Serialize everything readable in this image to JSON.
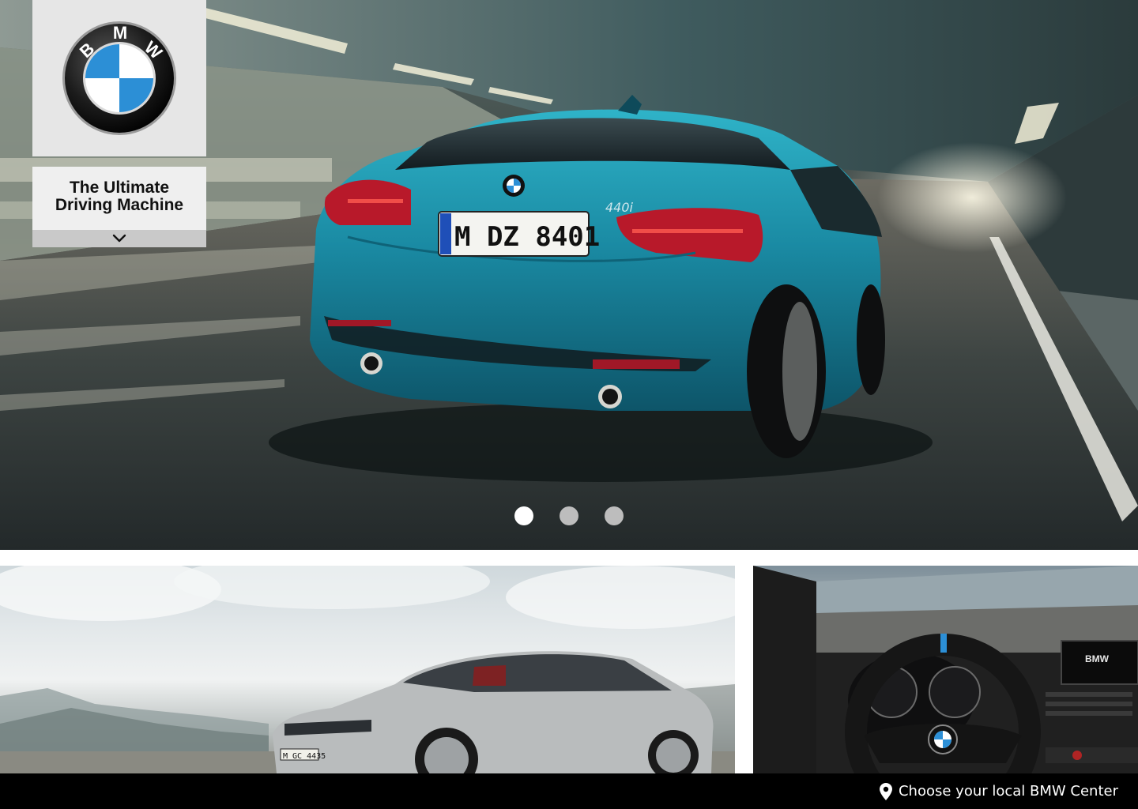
{
  "brand": {
    "logo_letters": "BMW",
    "tagline": "The Ultimate\nDriving Machine",
    "tagline_toggle_icon": "chevron-down-icon"
  },
  "hero": {
    "slide_count": 3,
    "active_slide": 1,
    "car_badge": "440i",
    "license_plate": "M DZ 8401"
  },
  "tiles": [
    {
      "name": "gran-coupe-tile",
      "license_plate": "M GC 4435"
    },
    {
      "name": "interior-tile",
      "screen_text": "BMW"
    }
  ],
  "footer": {
    "dealer_link_label": "Choose your local BMW Center",
    "dealer_icon": "map-pin-icon"
  },
  "colors": {
    "car_teal": "#1c8fa6",
    "bmw_blue": "#2c8fd6",
    "footer_bg": "#000000",
    "dot_active": "#ffffff",
    "dot_inactive": "#bdbdbd"
  }
}
